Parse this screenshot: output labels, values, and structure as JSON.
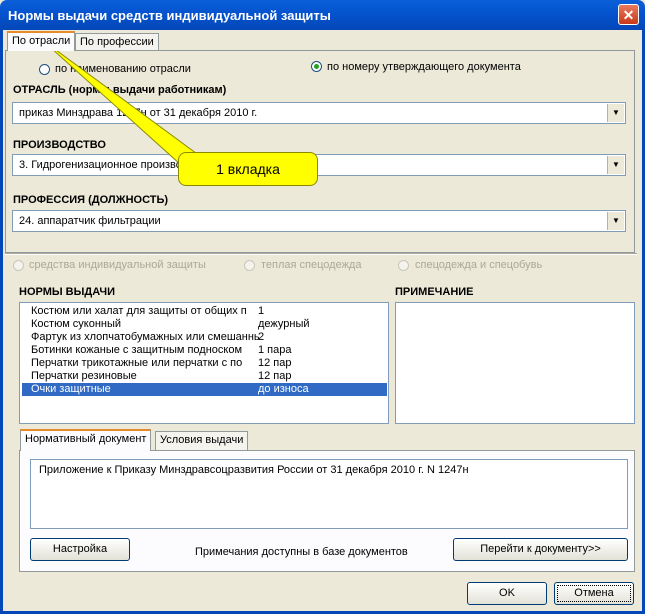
{
  "window": {
    "title": "Нормы выдачи средств индивидуальной защиты",
    "close": "✕"
  },
  "top_tabs": [
    "По отрасли",
    "По профессии"
  ],
  "mode": {
    "by_industry": "по наименованию отрасли",
    "by_document": "по номеру утверждающего документа",
    "selected": "by_document"
  },
  "industry": {
    "heading": "ОТРАСЛЬ (нормы выдачи работникам)",
    "value": "приказ Минздрава 1247н от 31 декабря 2010 г."
  },
  "production": {
    "heading": "ПРОИЗВОДСТВО",
    "value": "3. Гидрогенизационное производство"
  },
  "profession": {
    "heading": "ПРОФЕССИЯ (ДОЛЖНОСТЬ)",
    "value": "24. аппаратчик фильтрации"
  },
  "category": {
    "ppe": "средства индивидуальной защиты",
    "warm": "теплая спецодежда",
    "workwear": "спецодежда и спецобувь"
  },
  "norms": {
    "heading": "НОРМЫ ВЫДАЧИ",
    "rows": [
      {
        "item": "Костюм или халат для защиты от общих п",
        "qty": "1"
      },
      {
        "item": "Костюм суконный",
        "qty": "дежурный"
      },
      {
        "item": "Фартук из хлопчатобумажных или смешанных",
        "qty": "2"
      },
      {
        "item": "Ботинки кожаные с защитным подноском",
        "qty": "1 пара"
      },
      {
        "item": "Перчатки трикотажные или перчатки с по",
        "qty": "12 пар"
      },
      {
        "item": "Перчатки резиновые",
        "qty": "12 пар"
      },
      {
        "item": "Очки защитные",
        "qty": "до износа"
      }
    ],
    "selected_index": 6
  },
  "note": {
    "heading": "ПРИМЕЧАНИЕ",
    "text": ""
  },
  "bottom_tabs": [
    "Нормативный документ",
    "Условия выдачи"
  ],
  "document_text": "Приложение к Приказу Минздравсоцразвития России от 31 декабря 2010 г. N 1247н",
  "buttons": {
    "settings": "Настройка",
    "goto_doc": "Перейти к документу>>",
    "ok": "OK",
    "cancel": "Отмена"
  },
  "notes_available": "Примечания доступны в базе документов",
  "callout": "1 вкладка",
  "colors": {
    "titlebar": "#0554d0",
    "selection": "#316ac5",
    "callout": "#ffff00"
  }
}
